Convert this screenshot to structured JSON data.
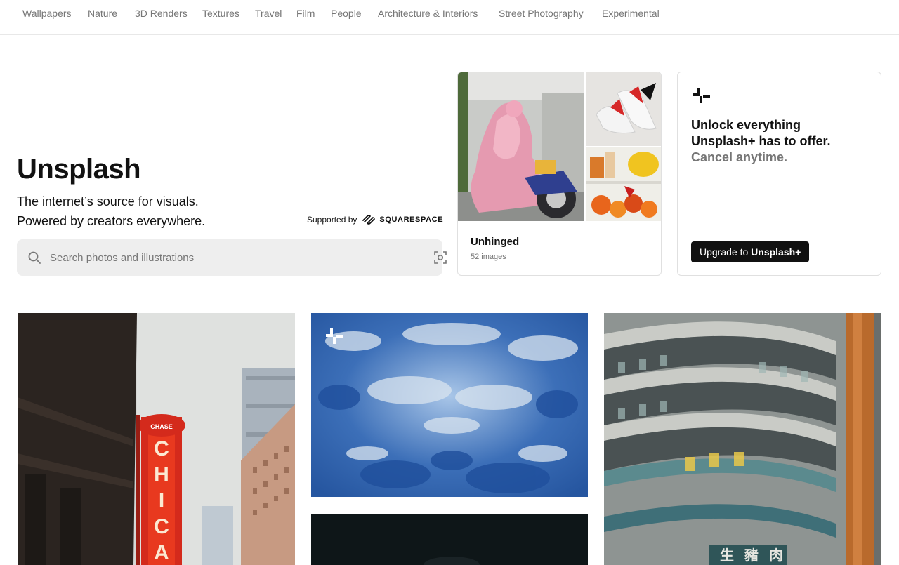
{
  "topics": [
    "Wallpapers",
    "Nature",
    "3D Renders",
    "Textures",
    "Travel",
    "Film",
    "People",
    "Architecture & Interiors",
    "Street Photography",
    "Experimental"
  ],
  "hero": {
    "title": "Unsplash",
    "subtitle_line1": "The internet’s source for visuals.",
    "subtitle_line2": "Powered by creators everywhere.",
    "supported_by": "Supported by",
    "sponsor": "SQUARESPACE"
  },
  "search": {
    "placeholder": "Search photos and illustrations"
  },
  "collection": {
    "title": "Unhinged",
    "count": "52 images"
  },
  "plus": {
    "headline": "Unlock everything Unsplash+ has to offer.",
    "subline": "Cancel anytime.",
    "button_prefix": "Upgrade to ",
    "button_brand": "Unsplash+"
  },
  "photos": [
    {
      "subject": "Chicago theatre sign street"
    },
    {
      "subject": "blue textured surface"
    },
    {
      "subject": "dark night scene"
    },
    {
      "subject": "Hong Kong apartment building"
    }
  ],
  "photo_sign_text": "CHICAGO",
  "colors": {
    "text": "#111111",
    "muted": "#767676",
    "search_bg": "#eeeeee",
    "button_bg": "#111111"
  }
}
